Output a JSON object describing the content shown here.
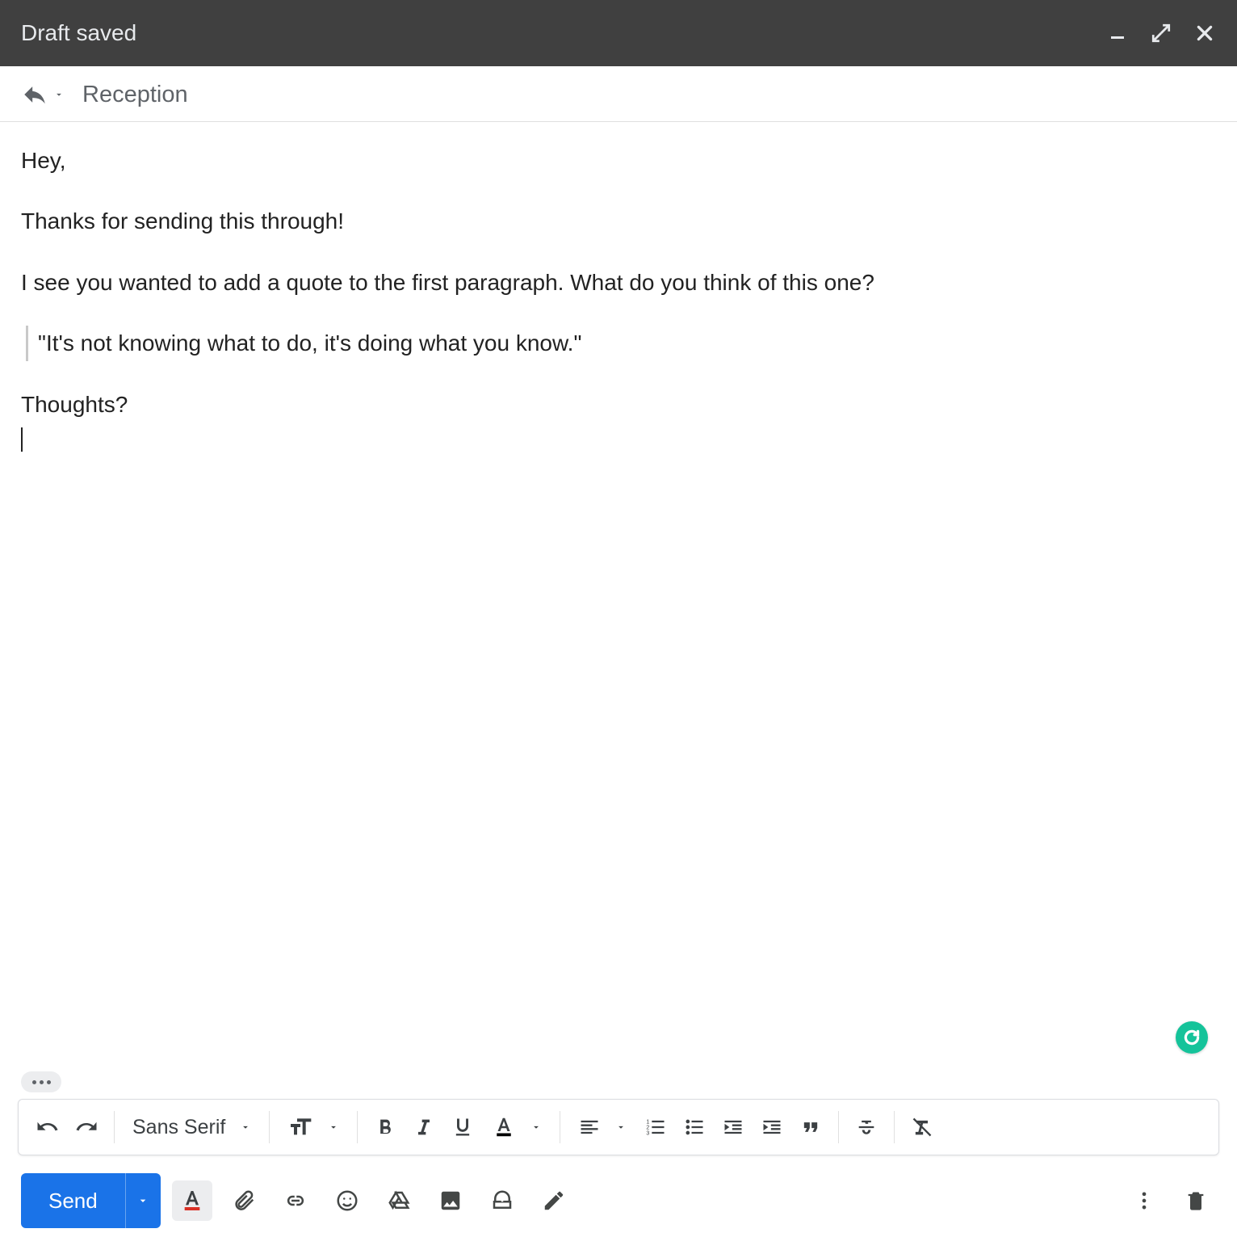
{
  "titlebar": {
    "title": "Draft saved"
  },
  "recipients": {
    "label": "Reception"
  },
  "body": {
    "p1": "Hey,",
    "p2": "Thanks for sending this through!",
    "p3": "I see you wanted to add a quote to the first paragraph. What do you think of this one?",
    "quote": "\"It's not knowing what to do, it's doing what you know.\"",
    "p4": "Thoughts?"
  },
  "toolbar": {
    "font": "Sans Serif"
  },
  "send": {
    "label": "Send"
  }
}
